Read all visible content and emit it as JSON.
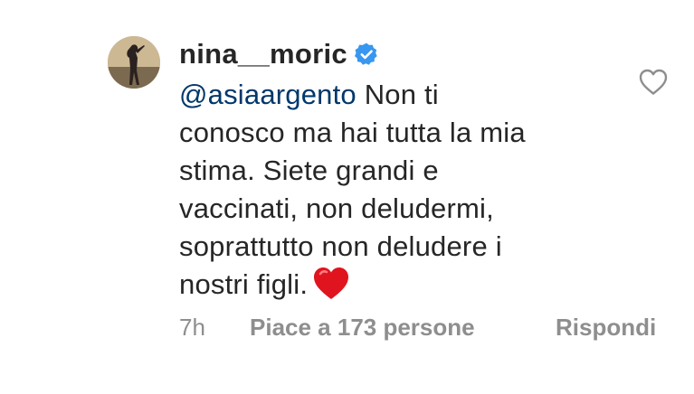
{
  "comment": {
    "username": "nina__moric",
    "verified": true,
    "mention": "@asiaargento",
    "lines": [
      " Non ti",
      "conosco ma hai tutta la mia",
      "stima. Siete grandi e",
      "vaccinati, non deludermi,",
      "soprattutto non deludere i",
      "nostri figli."
    ],
    "emoji": "red-heart-emoji",
    "time": "7h",
    "likes_label": "Piace a 173 persone",
    "reply_label": "Rispondi"
  },
  "icons": {
    "verified_badge": "verified-badge-icon",
    "like": "heart-outline-icon"
  },
  "colors": {
    "text": "#262626",
    "mention": "#00376b",
    "meta": "#8e8e8e",
    "verified": "#3897f0",
    "heart_emoji": "#e0141e"
  }
}
